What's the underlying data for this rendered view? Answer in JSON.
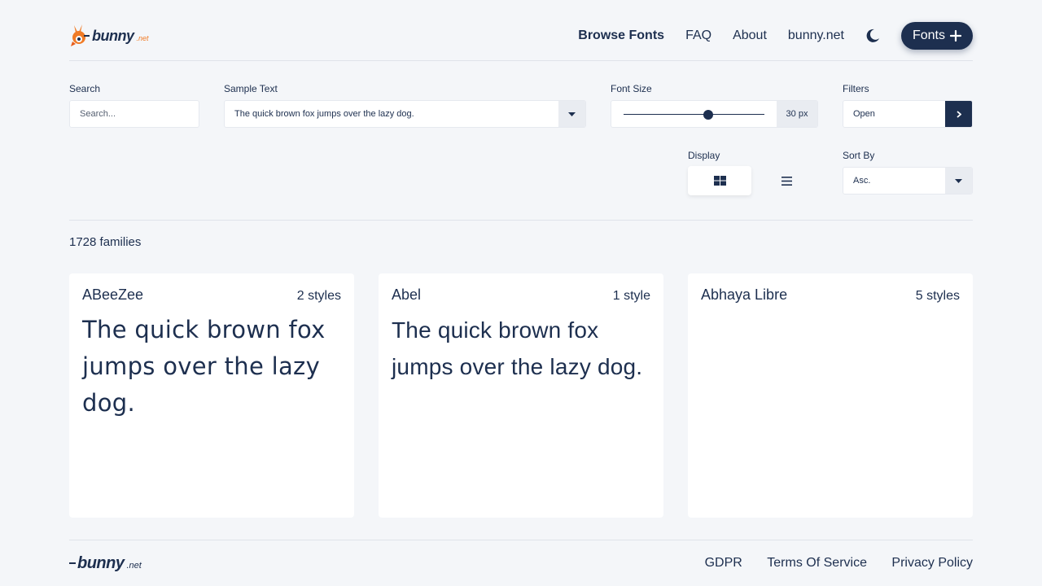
{
  "header": {
    "logo_word": "bunny",
    "logo_suffix": ".net",
    "nav": [
      "Browse Fonts",
      "FAQ",
      "About",
      "bunny.net"
    ],
    "cta_label": "Fonts"
  },
  "controls": {
    "search": {
      "label": "Search",
      "placeholder": "Search..."
    },
    "sample_text": {
      "label": "Sample Text",
      "value": "The quick brown fox jumps over the lazy dog."
    },
    "font_size": {
      "label": "Font Size",
      "value_label": "30 px",
      "slider_fraction": 0.6
    },
    "filters": {
      "label": "Filters",
      "value": "Open"
    },
    "display": {
      "label": "Display"
    },
    "sort": {
      "label": "Sort By",
      "value": "Asc."
    }
  },
  "results": {
    "count_label": "1728 families"
  },
  "cards": [
    {
      "name": "ABeeZee",
      "styles": "2 styles",
      "sample": "The quick brown fox jumps over the lazy dog."
    },
    {
      "name": "Abel",
      "styles": "1 style",
      "sample": "The quick brown fox jumps over the lazy dog."
    },
    {
      "name": "Abhaya Libre",
      "styles": "5 styles",
      "sample": ""
    }
  ],
  "footer": {
    "logo_word": "bunny",
    "logo_suffix": ".net",
    "links": [
      "GDPR",
      "Terms Of Service",
      "Privacy Policy"
    ]
  },
  "colors": {
    "navy": "#1d2f4f",
    "accent": "#f07b26",
    "background": "#f4f6f9"
  }
}
